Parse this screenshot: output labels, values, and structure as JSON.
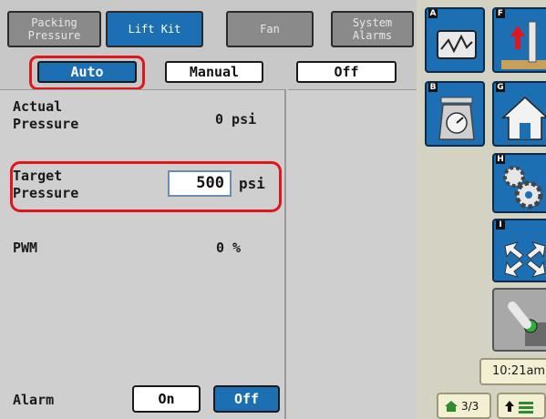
{
  "tabs": [
    {
      "label": "Packing\nPressure",
      "active": false
    },
    {
      "label": "Lift Kit",
      "active": true
    },
    {
      "label": "Fan",
      "active": false
    },
    {
      "label": "System\nAlarms",
      "active": false
    }
  ],
  "mode": {
    "buttons": [
      "Auto",
      "Manual",
      "Off"
    ],
    "selected": "Auto"
  },
  "readings": {
    "actual_label": "Actual\nPressure",
    "actual_value": "0 psi",
    "target_label": "Target\nPressure",
    "target_value": "500",
    "target_unit": "psi",
    "pwm_label": "PWM",
    "pwm_value": "0 %"
  },
  "alarm": {
    "label": "Alarm",
    "on_label": "On",
    "off_label": "Off",
    "selected": "Off"
  },
  "shortcuts": [
    {
      "letter": "A",
      "icon": "chart-icon"
    },
    {
      "letter": "F",
      "icon": "lift-icon"
    },
    {
      "letter": "B",
      "icon": "scale-icon"
    },
    {
      "letter": "G",
      "icon": "home-icon"
    },
    {
      "letter": "H",
      "icon": "gears-icon"
    },
    {
      "letter": "I",
      "icon": "arrows-icon"
    },
    {
      "letter": "",
      "icon": "joystick-icon"
    }
  ],
  "clock": "10:21am",
  "pager": {
    "page": "3/3"
  },
  "colors": {
    "accent": "#1c6fb3",
    "highlight": "#e0161b",
    "panel": "#cfcfcf"
  }
}
